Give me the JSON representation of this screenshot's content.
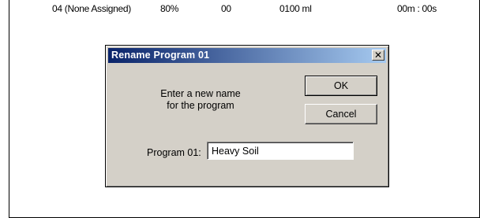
{
  "table": {
    "row": {
      "name": "04 (None Assigned)",
      "percent": "80%",
      "number": "00",
      "volume": "0100 ml",
      "time": "00m : 00s"
    }
  },
  "dialog": {
    "title": "Rename Program 01",
    "close_glyph": "✕",
    "prompt_line1": "Enter a new name",
    "prompt_line2": "for the program",
    "ok_label": "OK",
    "cancel_label": "Cancel",
    "field_label": "Program 01:",
    "field_value": "Heavy Soil"
  },
  "colors": {
    "dialog_bg": "#d4d0c8",
    "titlebar_start": "#0a246a",
    "titlebar_end": "#a6caf0"
  },
  "icons": {
    "close": "close-icon"
  }
}
